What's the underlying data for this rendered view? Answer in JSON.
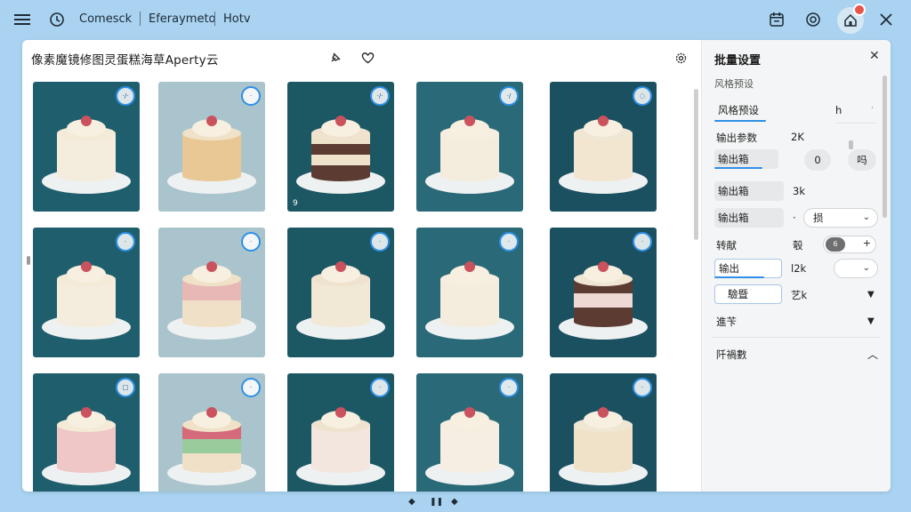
{
  "topbar": {
    "menu_icon": "hamburger-menu-icon",
    "history_icon": "clock-icon",
    "links": [
      "Comesck",
      "Eferaymeto",
      "Hotv"
    ],
    "calendar_icon": "calendar-icon",
    "gear_icon": "settings-gear-icon",
    "notification_icon": "home-notification-icon",
    "close_icon": "close-icon"
  },
  "doc": {
    "title": "像素魔镜修图灵蛋糕海草Aperty云",
    "pin_icon": "pin-icon",
    "favorite_icon": "heart-icon",
    "settings_icon": "gear-icon"
  },
  "grid": {
    "cells": [
      {
        "ring": "·/·",
        "num": ""
      },
      {
        "ring": "·",
        "num": ""
      },
      {
        "ring": "·/·",
        "num": "9"
      },
      {
        "ring": "·/",
        "num": ""
      },
      {
        "ring": "◌",
        "num": ""
      },
      {
        "ring": "·",
        "num": ""
      },
      {
        "ring": "·",
        "num": ""
      },
      {
        "ring": "·",
        "num": ""
      },
      {
        "ring": "·",
        "num": ""
      },
      {
        "ring": "·",
        "num": ""
      },
      {
        "ring": "□",
        "num": ""
      },
      {
        "ring": "·",
        "num": ""
      },
      {
        "ring": "·",
        "num": ""
      },
      {
        "ring": "·",
        "num": ""
      },
      {
        "ring": "·",
        "num": ""
      }
    ]
  },
  "side": {
    "title": "批量设置",
    "subtitle": "风格预设",
    "rows": {
      "style_preset_label": "风格预设",
      "style_preset_value": "h",
      "output_params_label": "输出参数",
      "output_params_value": "2K",
      "output_a_label": "输出箱",
      "output_a_pill1": "0",
      "output_a_pill2": "吗",
      "output_b_label": "输出箱",
      "output_b_value": "3k",
      "output_c_label": "输出箱",
      "output_c_dot": "·",
      "output_c_select": "损",
      "toggle_label": "转献",
      "toggle_mid": "彀",
      "toggle_knob": "6",
      "output_d_label": "输出",
      "output_d_value": "l2k",
      "quality_label": "驗暨",
      "quality_value": "艺k",
      "advanced_label": "進苄",
      "footer_label": "阡禍數"
    }
  },
  "pager": {
    "prev": "◆",
    "pause": "❚❚",
    "next": "◆"
  }
}
